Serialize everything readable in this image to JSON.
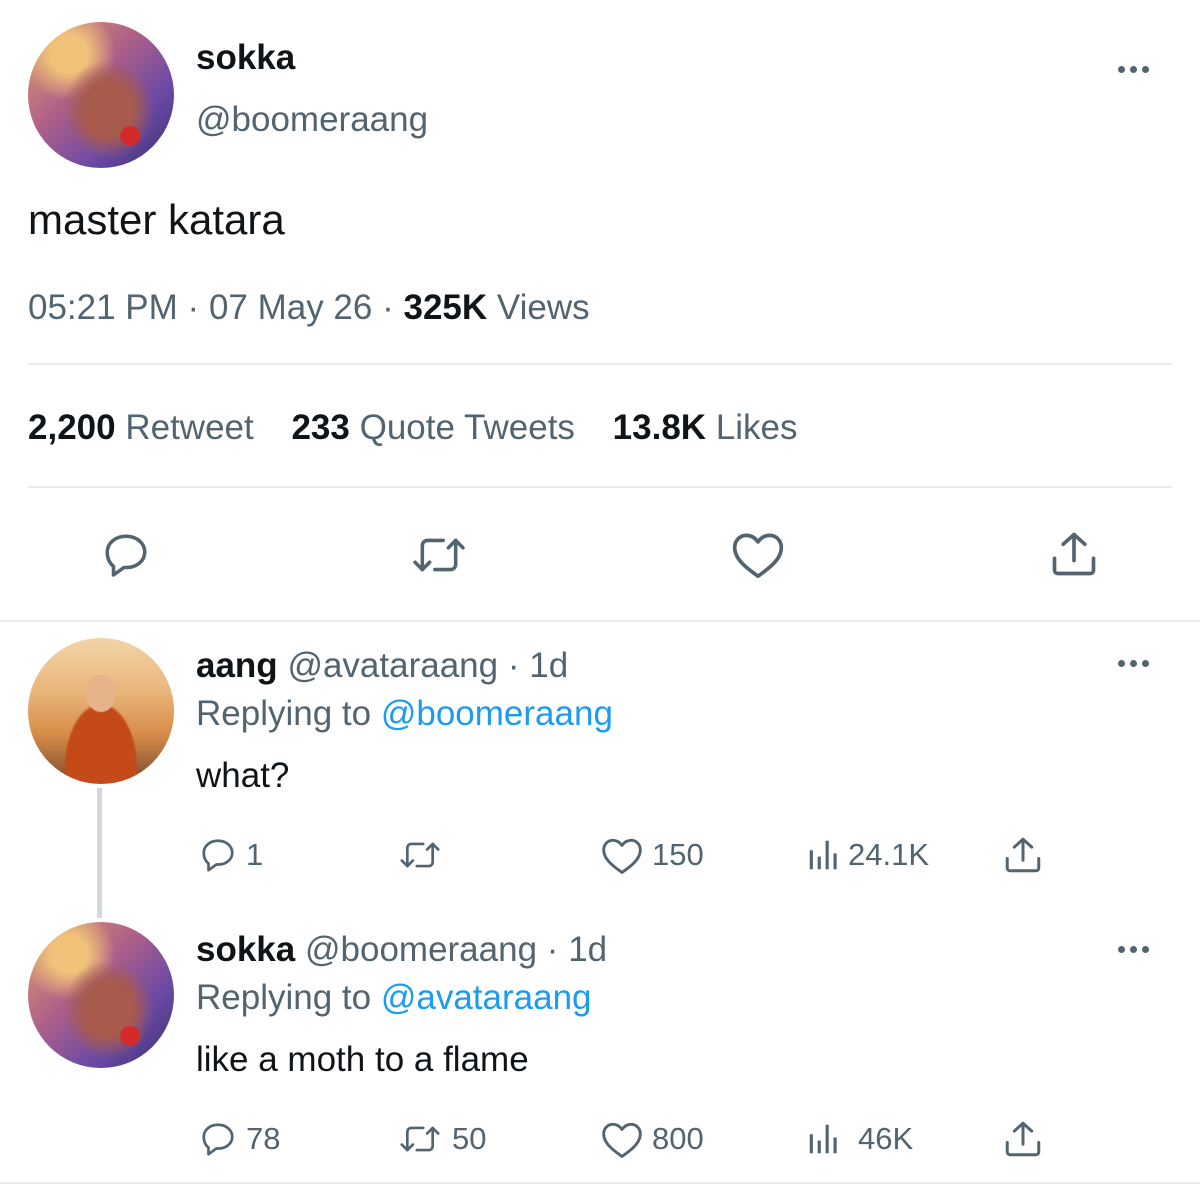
{
  "main_tweet": {
    "display_name": "sokka",
    "handle": "@boomeraang",
    "text": "master katara",
    "time": "05:21 PM",
    "date": "07 May 26",
    "views_count": "325K",
    "views_label": "Views",
    "retweets_count": "2,200",
    "retweets_label": "Retweet",
    "quotes_count": "233",
    "quotes_label": "Quote Tweets",
    "likes_count": "13.8K",
    "likes_label": "Likes"
  },
  "replies": [
    {
      "display_name": "aang",
      "handle": "@avataraang",
      "age": "1d",
      "replying_label": "Replying to",
      "replying_to": "@boomeraang",
      "text": "what?",
      "reply_count": "1",
      "retweet_count": "",
      "like_count": "150",
      "view_count": "24.1K"
    },
    {
      "display_name": "sokka",
      "handle": "@boomeraang",
      "age": "1d",
      "replying_label": "Replying to",
      "replying_to": "@avataraang",
      "text": "like a moth to a flame",
      "reply_count": "78",
      "retweet_count": "50",
      "like_count": "800",
      "view_count": "46K"
    }
  ],
  "icons": {
    "reply": "reply-icon",
    "retweet": "retweet-icon",
    "like": "heart-icon",
    "views": "views-icon",
    "share": "share-icon",
    "more": "more-icon"
  },
  "colors": {
    "link": "#1d9bf0",
    "secondary_text": "#536471",
    "primary_text": "#0f1419",
    "divider": "#e6ecf0"
  }
}
